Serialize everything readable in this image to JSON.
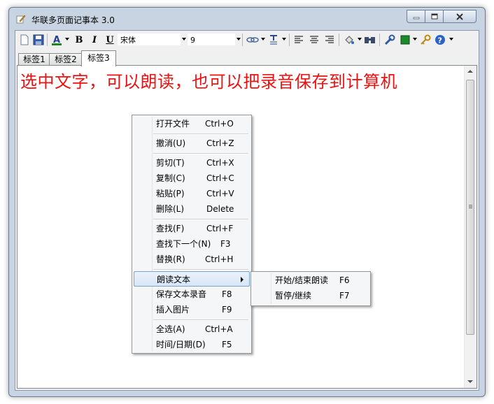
{
  "window": {
    "title": "华联多页面记事本 3.0"
  },
  "toolbar": {
    "font_name": "宋体",
    "font_size": "9",
    "icons": [
      "new-file-icon",
      "save-icon",
      "font-color-icon",
      "bold-icon",
      "italic-icon",
      "underline-icon",
      "link-icon",
      "format-icon",
      "align-left-icon",
      "align-center-icon",
      "align-right-icon",
      "fill-color-icon",
      "find-icon",
      "tools-icon",
      "color-block-icon",
      "key-icon",
      "help-icon"
    ],
    "bold_glyph": "B",
    "italic_glyph": "I",
    "underline_glyph": "U"
  },
  "tabs": [
    {
      "label": "标签1",
      "active": false
    },
    {
      "label": "标签2",
      "active": false
    },
    {
      "label": "标签3",
      "active": true
    }
  ],
  "editor": {
    "content": "选中文字，可以朗读，也可以把录音保存到计算机",
    "text_color": "#ee1111"
  },
  "context_menu": {
    "items": [
      {
        "label": "打开文件",
        "shortcut": "Ctrl+O"
      },
      {
        "label": "撤消(U)",
        "shortcut": "Ctrl+Z"
      },
      {
        "label": "剪切(T)",
        "shortcut": "Ctrl+X"
      },
      {
        "label": "复制(C)",
        "shortcut": "Ctrl+C"
      },
      {
        "label": "粘贴(P)",
        "shortcut": "Ctrl+V"
      },
      {
        "label": "删除(L)",
        "shortcut": "Delete"
      },
      {
        "label": "查找(F)",
        "shortcut": "Ctrl+F"
      },
      {
        "label": "查找下一个(N)",
        "shortcut": "F3"
      },
      {
        "label": "替换(R)",
        "shortcut": "Ctrl+H"
      },
      {
        "label": "朗读文本",
        "shortcut": ""
      },
      {
        "label": "保存文本录音",
        "shortcut": "F8"
      },
      {
        "label": "插入图片",
        "shortcut": "F9"
      },
      {
        "label": "全选(A)",
        "shortcut": "Ctrl+A"
      },
      {
        "label": "时间/日期(D)",
        "shortcut": "F5"
      }
    ]
  },
  "submenu": {
    "items": [
      {
        "label": "开始/结束朗读",
        "shortcut": "F6"
      },
      {
        "label": "暂停/继续",
        "shortcut": "F7"
      }
    ]
  }
}
